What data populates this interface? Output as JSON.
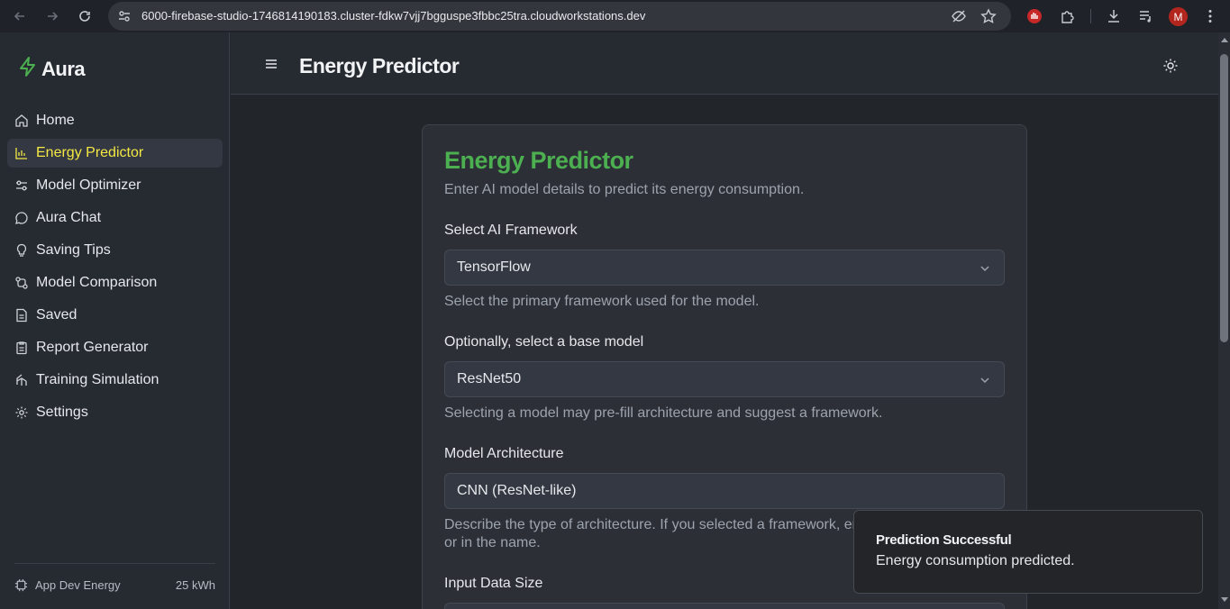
{
  "browser": {
    "url": "6000-firebase-studio-1746814190183.cluster-fdkw7vjj7bgguspe3fbbc25tra.cloudworkstations.dev",
    "profile_initial": "M"
  },
  "sidebar": {
    "brand": "Aura",
    "items": [
      {
        "label": "Home",
        "icon": "home-icon",
        "active": false
      },
      {
        "label": "Energy Predictor",
        "icon": "bar-chart-icon",
        "active": true
      },
      {
        "label": "Model Optimizer",
        "icon": "sliders-icon",
        "active": false
      },
      {
        "label": "Aura Chat",
        "icon": "chat-bubble-icon",
        "active": false
      },
      {
        "label": "Saving Tips",
        "icon": "lightbulb-icon",
        "active": false
      },
      {
        "label": "Model Comparison",
        "icon": "compare-icon",
        "active": false
      },
      {
        "label": "Saved",
        "icon": "document-icon",
        "active": false
      },
      {
        "label": "Report Generator",
        "icon": "clipboard-icon",
        "active": false
      },
      {
        "label": "Training Simulation",
        "icon": "simulation-icon",
        "active": false
      },
      {
        "label": "Settings",
        "icon": "gear-icon",
        "active": false
      }
    ],
    "footer": {
      "label": "App Dev Energy",
      "value": "25 kWh"
    }
  },
  "header": {
    "title": "Energy Predictor"
  },
  "form": {
    "title": "Energy Predictor",
    "description": "Enter AI model details to predict its energy consumption.",
    "framework": {
      "label": "Select AI Framework",
      "value": "TensorFlow",
      "help": "Select the primary framework used for the model."
    },
    "base_model": {
      "label": "Optionally, select a base model",
      "value": "ResNet50",
      "help": "Selecting a model may pre-fill architecture and suggest a framework."
    },
    "architecture": {
      "label": "Model Architecture",
      "value": "CNN (ResNet-like)",
      "help_line1": "Describe the type of architecture. If you selected a framework, ens",
      "help_line2": "or in the name."
    },
    "input_size": {
      "label": "Input Data Size"
    }
  },
  "toast": {
    "title": "Prediction Successful",
    "message": "Energy consumption predicted."
  },
  "colors": {
    "accent": "#4caf50",
    "active_nav": "#f4e842"
  }
}
